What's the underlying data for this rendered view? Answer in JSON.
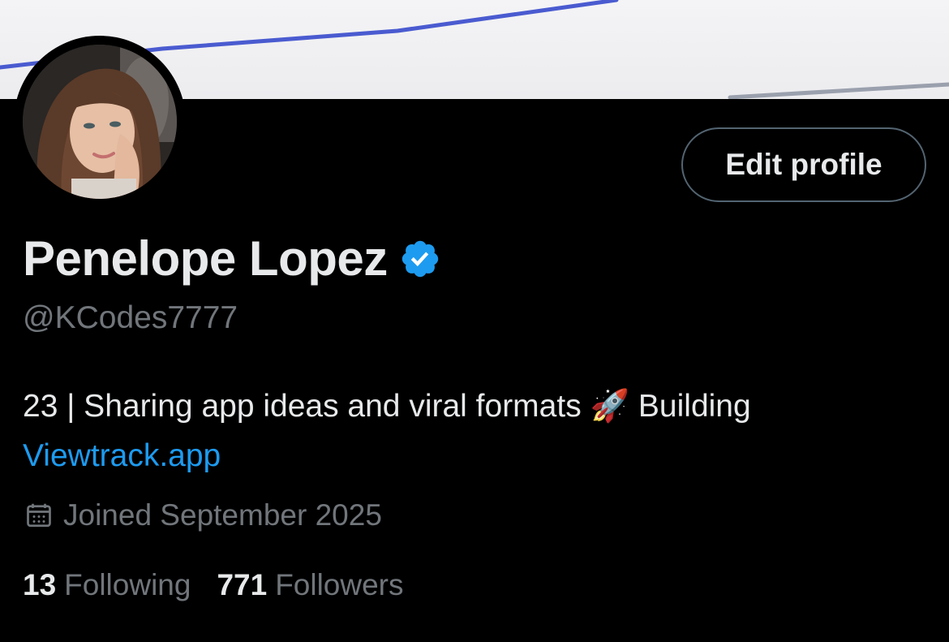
{
  "profile": {
    "name": "Penelope Lopez",
    "handle": "@KCodes7777",
    "bio_text": "23 | Sharing app ideas and viral formats 🚀 Building",
    "bio_link": "Viewtrack.app",
    "joined": "Joined September 2025",
    "verified": true
  },
  "actions": {
    "edit_profile_label": "Edit profile"
  },
  "stats": {
    "following_count": "13",
    "following_label": "Following",
    "followers_count": "771",
    "followers_label": "Followers"
  },
  "colors": {
    "background": "#000000",
    "primary_text": "#e7e9ea",
    "secondary_text": "#71767b",
    "link": "#1d9bf0",
    "verified_badge": "#1d9bf0",
    "banner_line": "#4a5bd0"
  },
  "icons": {
    "verified": "verified-badge-icon",
    "calendar": "calendar-icon"
  }
}
